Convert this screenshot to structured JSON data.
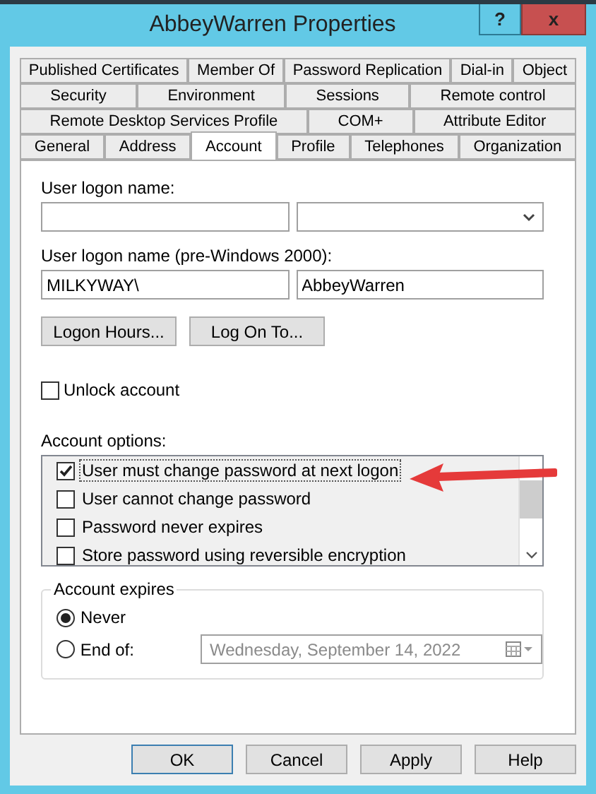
{
  "window": {
    "title": "AbbeyWarren Properties",
    "help_button": "?",
    "close_button": "x"
  },
  "tab_rows": [
    [
      {
        "label": "Published Certificates",
        "selected": false
      },
      {
        "label": "Member Of",
        "selected": false
      },
      {
        "label": "Password Replication",
        "selected": false
      },
      {
        "label": "Dial-in",
        "selected": false
      },
      {
        "label": "Object",
        "selected": false
      }
    ],
    [
      {
        "label": "Security",
        "selected": false
      },
      {
        "label": "Environment",
        "selected": false
      },
      {
        "label": "Sessions",
        "selected": false
      },
      {
        "label": "Remote control",
        "selected": false
      }
    ],
    [
      {
        "label": "Remote Desktop Services Profile",
        "selected": false
      },
      {
        "label": "COM+",
        "selected": false
      },
      {
        "label": "Attribute Editor",
        "selected": false
      }
    ],
    [
      {
        "label": "General",
        "selected": false
      },
      {
        "label": "Address",
        "selected": false
      },
      {
        "label": "Account",
        "selected": true
      },
      {
        "label": "Profile",
        "selected": false
      },
      {
        "label": "Telephones",
        "selected": false
      },
      {
        "label": "Organization",
        "selected": false
      }
    ]
  ],
  "user_logon_name": {
    "label": "User logon name:"
  },
  "pre_windows_2000": {
    "label": "User logon name (pre-Windows 2000):",
    "domain": "MILKYWAY\\",
    "name": "AbbeyWarren"
  },
  "logon_buttons": [
    "Logon Hours...",
    "Log On To..."
  ],
  "unlock_account": {
    "label": "Unlock account",
    "checked": false
  },
  "account_options": {
    "label": "Account options:",
    "items": [
      {
        "label": "User must change password at next logon",
        "checked": true
      },
      {
        "label": "User cannot change password",
        "checked": false
      },
      {
        "label": "Password never expires",
        "checked": false
      },
      {
        "label": "Store password using reversible encryption",
        "checked": false
      }
    ]
  },
  "account_expires": {
    "label": "Account expires",
    "options": [
      {
        "label": "Never",
        "selected": true
      },
      {
        "label": "End of:",
        "selected": false
      }
    ],
    "date": "Wednesday, September 14, 2022"
  },
  "buttons": [
    "OK",
    "Cancel",
    "Apply",
    "Help"
  ]
}
